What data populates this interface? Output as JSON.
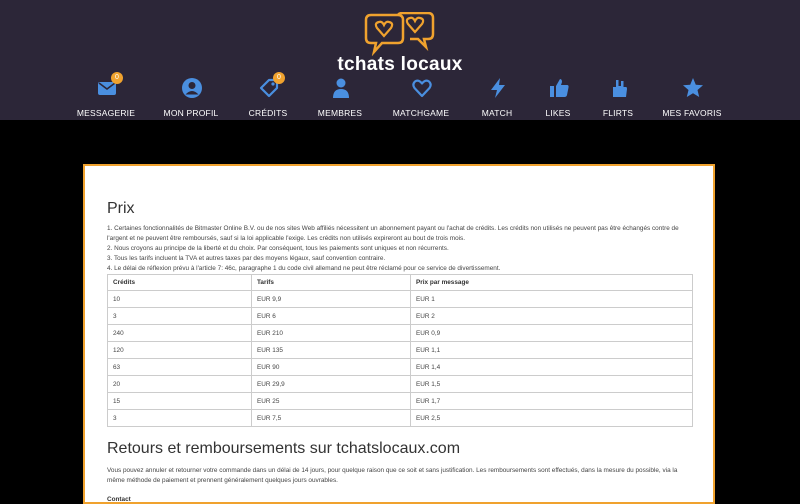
{
  "brand": {
    "logo_text": "tchats locaux",
    "accent": "#f0a22e",
    "header_bg": "#2c2638",
    "icon_color": "#4a8fe0"
  },
  "nav": [
    {
      "label": "MESSAGERIE",
      "icon": "envelope-icon",
      "badge": "0"
    },
    {
      "label": "MON PROFIL",
      "icon": "user-circle-icon",
      "badge": ""
    },
    {
      "label": "CRÉDITS",
      "icon": "tag-icon",
      "badge": "0"
    },
    {
      "label": "MEMBRES",
      "icon": "person-icon",
      "badge": ""
    },
    {
      "label": "MATCHGAME",
      "icon": "heart-icon",
      "badge": ""
    },
    {
      "label": "MATCH",
      "icon": "lightning-icon",
      "badge": ""
    },
    {
      "label": "LIKES",
      "icon": "thumbs-up-icon",
      "badge": ""
    },
    {
      "label": "FLIRTS",
      "icon": "hand-icon",
      "badge": ""
    },
    {
      "label": "MES FAVORIS",
      "icon": "star-icon",
      "badge": ""
    }
  ],
  "prix": {
    "title": "Prix",
    "lines": [
      "1. Certaines fonctionnalités de Bitmaster Online B.V. ou de nos sites Web affiliés nécessitent un abonnement payant ou l'achat de crédits. Les crédits non utilisés ne peuvent pas être échangés contre de l'argent et ne peuvent être remboursés, sauf si la loi applicable l'exige. Les crédits non utilisés expireront au bout de trois mois.",
      "2. Nous croyons au principe de la liberté et du choix. Par conséquent, tous les paiements sont uniques et non récurrents.",
      "3. Tous les tarifs incluent la TVA et autres taxes par des moyens légaux, sauf convention contraire.",
      "4. Le délai de réflexion prévu à l'article 7: 46c, paragraphe 1 du code civil allemand ne peut être réclamé pour ce service de divertissement."
    ],
    "table": {
      "headers": [
        "Crédits",
        "Tarifs",
        "Prix par message"
      ],
      "rows": [
        [
          "10",
          "EUR 9,9",
          "EUR 1"
        ],
        [
          "3",
          "EUR 6",
          "EUR 2"
        ],
        [
          "240",
          "EUR 210",
          "EUR 0,9"
        ],
        [
          "120",
          "EUR 135",
          "EUR 1,1"
        ],
        [
          "63",
          "EUR 90",
          "EUR 1,4"
        ],
        [
          "20",
          "EUR 29,9",
          "EUR 1,5"
        ],
        [
          "15",
          "EUR 25",
          "EUR 1,7"
        ],
        [
          "3",
          "EUR 7,5",
          "EUR 2,5"
        ]
      ]
    }
  },
  "retours": {
    "title": "Retours et remboursements sur tchatslocaux.com",
    "text": "Vous pouvez annuler et retourner votre commande dans un délai de 14 jours, pour quelque raison que ce soit et sans justification. Les remboursements sont effectués, dans la mesure du possible, via la même méthode de paiement et prennent généralement quelques jours ouvrables.",
    "contact_label": "Contact"
  }
}
